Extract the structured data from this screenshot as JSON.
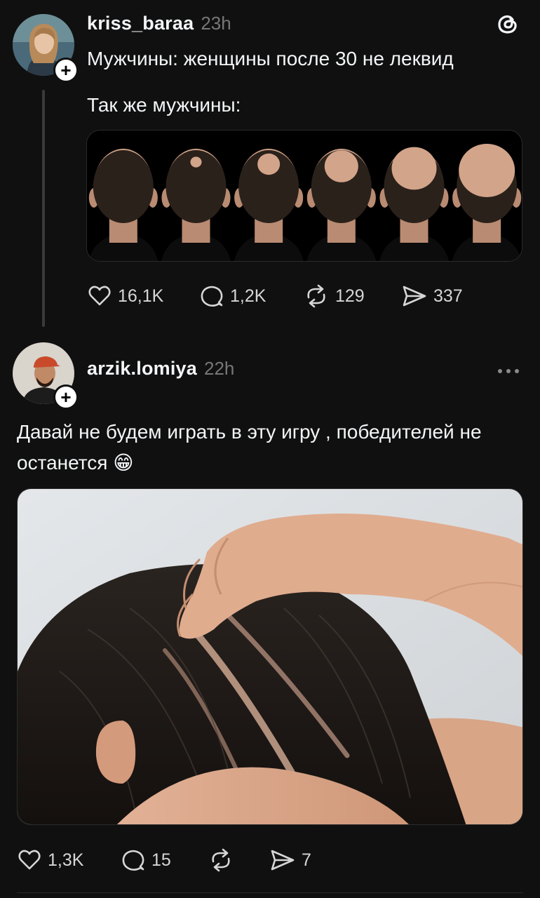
{
  "post1": {
    "username": "kriss_baraa",
    "time": "23h",
    "text_line1": "Мужчины: женщины после 30 не леквид",
    "text_line2": "Так же мужчины:",
    "actions": {
      "likes": "16,1K",
      "replies": "1,2K",
      "reposts": "129",
      "shares": "337"
    }
  },
  "post2": {
    "username": "arzik.lomiya",
    "time": "22h",
    "text": "Давай не будем играть в эту игру , победителей не останется",
    "emoji": "😁",
    "actions": {
      "likes": "1,3K",
      "replies": "15",
      "reposts": "",
      "shares": "7"
    }
  },
  "follow_symbol": "+",
  "icons": [
    "threads-logo-icon",
    "heart-icon",
    "comment-icon",
    "repost-icon",
    "send-icon",
    "more-icon"
  ],
  "colors": {
    "background": "#101010",
    "text": "#f3f5f7",
    "muted": "#777777"
  }
}
